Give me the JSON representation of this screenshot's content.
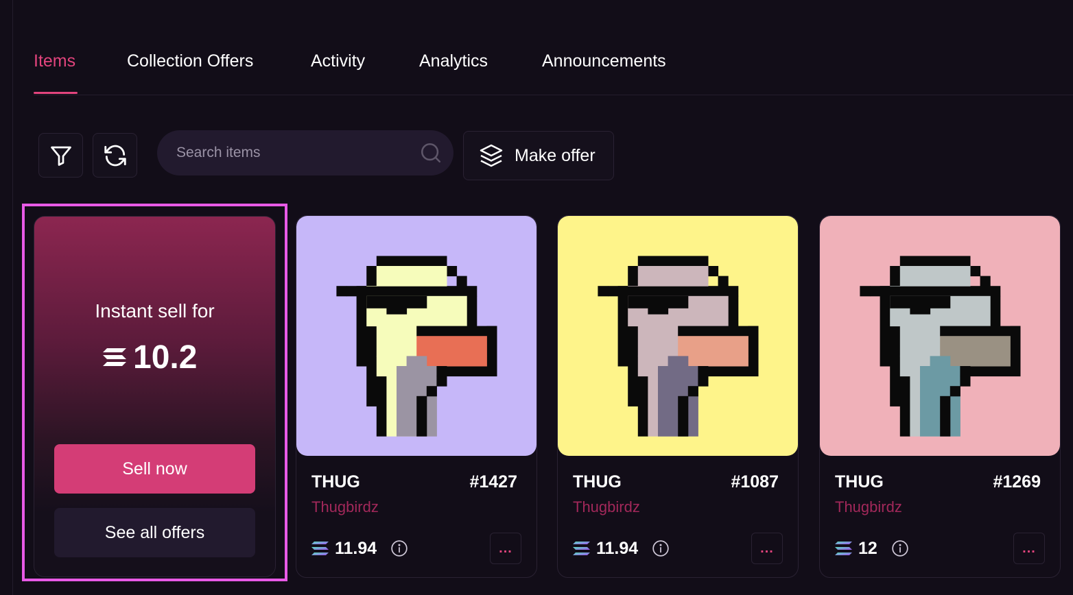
{
  "tabs": [
    {
      "label": "Items",
      "active": true
    },
    {
      "label": "Collection Offers",
      "active": false
    },
    {
      "label": "Activity",
      "active": false
    },
    {
      "label": "Analytics",
      "active": false
    },
    {
      "label": "Announcements",
      "active": false
    }
  ],
  "toolbar": {
    "filter_icon": "filter-icon",
    "refresh_icon": "refresh-icon",
    "search_placeholder": "Search items",
    "make_offer_label": "Make offer"
  },
  "instant_sell": {
    "title": "Instant sell for",
    "price": "10.2",
    "sell_now_label": "Sell now",
    "see_all_offers_label": "See all offers"
  },
  "items": [
    {
      "name": "THUG",
      "id": "#1427",
      "collection": "Thugbirdz",
      "price": "11.94",
      "more_label": "...",
      "bg": "#c6b7f9",
      "head": "#f6fcbb",
      "beak": "#e86f55",
      "shade": "#9b94a3"
    },
    {
      "name": "THUG",
      "id": "#1087",
      "collection": "Thugbirdz",
      "price": "11.94",
      "more_label": "...",
      "bg": "#fef48a",
      "head": "#ccb6bb",
      "beak": "#e8a088",
      "shade": "#726b85"
    },
    {
      "name": "THUG",
      "id": "#1269",
      "collection": "Thugbirdz",
      "price": "12",
      "more_label": "...",
      "bg": "#f0b1b9",
      "head": "#bfc7c8",
      "beak": "#9a9183",
      "shade": "#6c9aa4"
    }
  ],
  "colors": {
    "accent": "#e2447d",
    "background": "#120d18",
    "highlight": "#e85ae6"
  }
}
